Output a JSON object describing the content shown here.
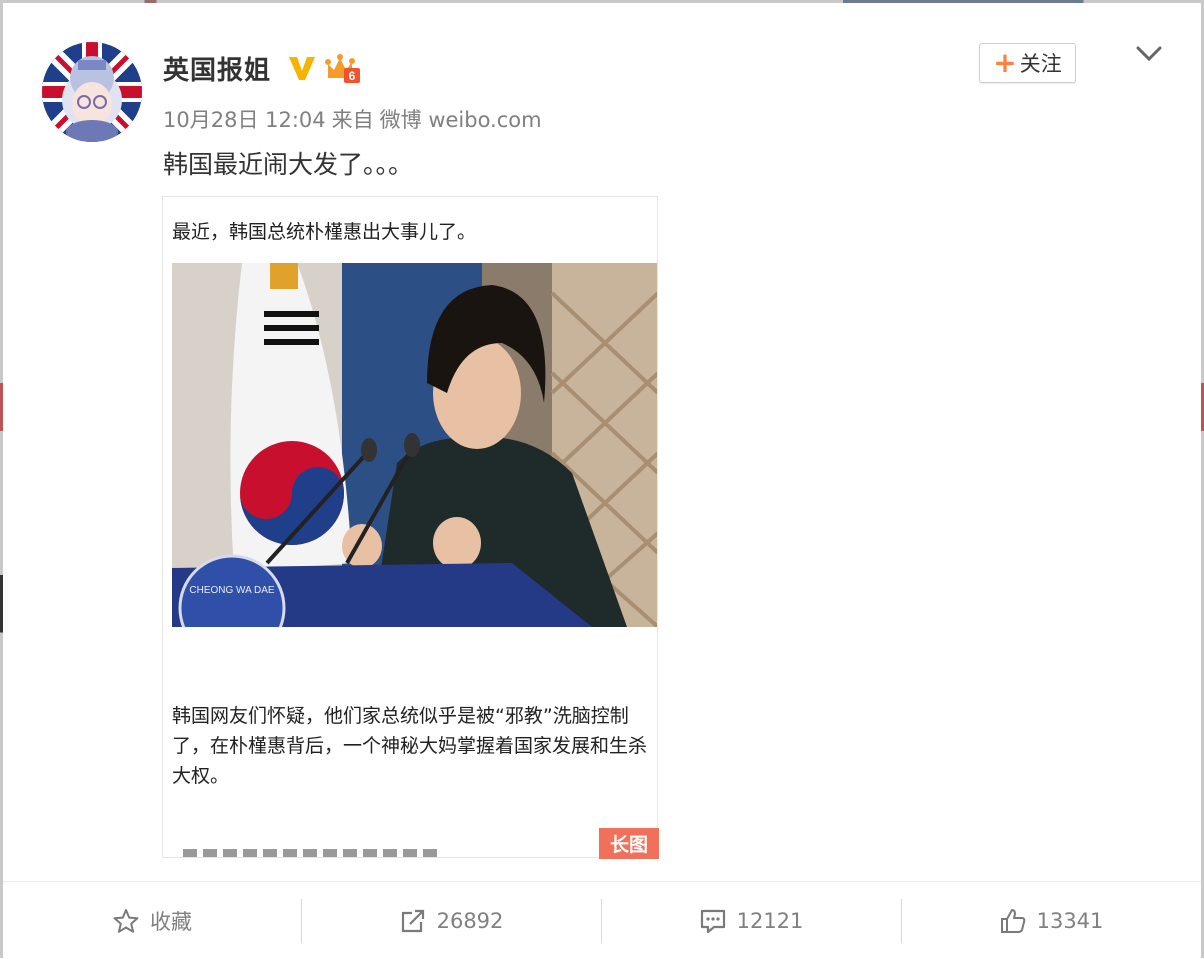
{
  "post": {
    "username": "英国报姐",
    "date": "10月28日 12:04",
    "source_prefix": "来自",
    "source": "微博 weibo.com",
    "text": "韩国最近闹大发了。。。",
    "follow_label": "关注",
    "follow_icon": "plus-icon",
    "badges": [
      "verified-v-icon",
      "vip-crown-icon"
    ],
    "badge_level": "6"
  },
  "long_image": {
    "intro": "最近，韩国总统朴槿惠出大事儿了。",
    "paragraph": "韩国网友们怀疑，他们家总统似乎是被“邪教”洗脑控制了，在朴槿惠背后，一个神秘大妈掌握着国家发展和生杀大权。",
    "badge": "长图",
    "photo_text": "CHEONG WA DAE"
  },
  "actions": {
    "favorite": {
      "label": "收藏",
      "icon": "star-icon"
    },
    "repost": {
      "count": "26892",
      "icon": "share-icon"
    },
    "comment": {
      "count": "12121",
      "icon": "comment-icon"
    },
    "like": {
      "count": "13341",
      "icon": "thumbs-up-icon"
    }
  },
  "colors": {
    "accent": "#ff8140",
    "long_badge": "#f0705b",
    "meta_text": "#808080"
  }
}
